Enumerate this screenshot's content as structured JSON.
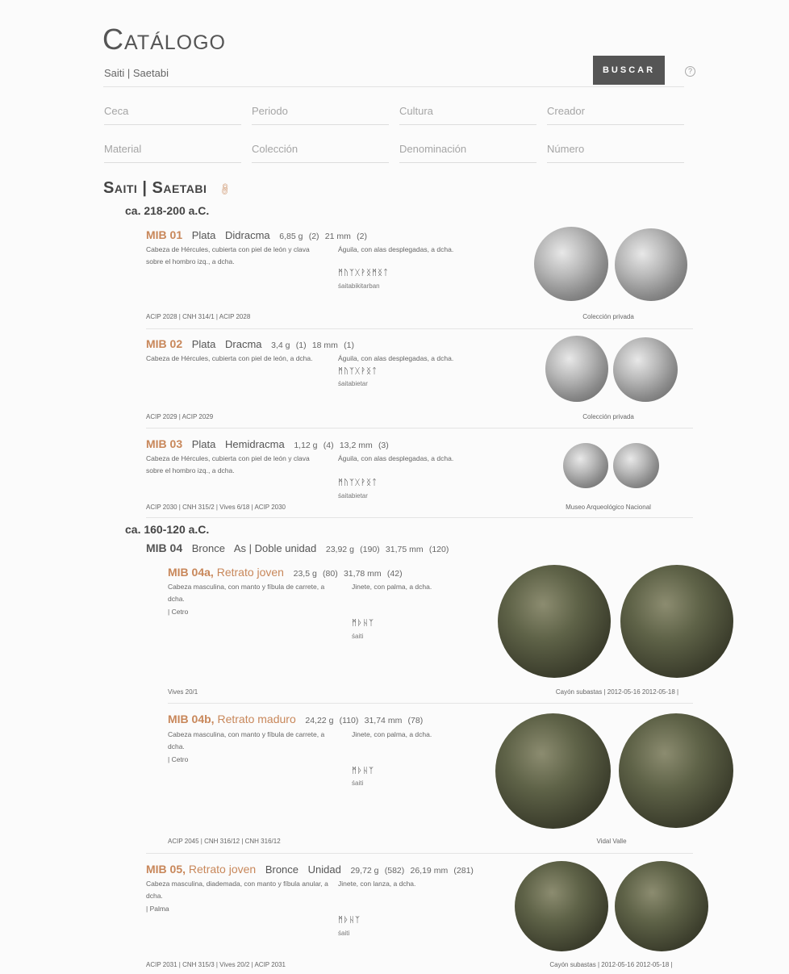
{
  "header": {
    "title": "Catálogo",
    "search_value": "Saiti | Saetabi",
    "search_button": "BUSCAR",
    "help_icon": "?"
  },
  "filters": {
    "ceca": "Ceca",
    "periodo": "Periodo",
    "cultura": "Cultura",
    "creador": "Creador",
    "material": "Material",
    "coleccion": "Colección",
    "denominacion": "Denominación",
    "numero": "Número"
  },
  "mint": {
    "name": "Saiti | Saetabi",
    "link_icon": "link-icon"
  },
  "periods": [
    "ca. 218-200 a.C.",
    "ca. 160-120 a.C."
  ],
  "coins": {
    "mib01": {
      "code": "MIB 01",
      "metal": "Plata",
      "denomination": "Didracma",
      "weight": "6,85 g",
      "weight_n": "(2)",
      "diameter": "21 mm",
      "diameter_n": "(2)",
      "obverse": "Cabeza de Hércules, cubierta con piel de león y clava sobre el hombro izq., a dcha.",
      "reverse": "Águila, con alas desplegadas, a dcha.",
      "legend": "ᛗᚢᛉᚷᚹᛝᛗᛝᛏ",
      "translit": "śaitabikitarban",
      "refs": "ACIP 2028 | CNH 314/1 | ACIP 2028",
      "collection": "Colección privada"
    },
    "mib02": {
      "code": "MIB 02",
      "metal": "Plata",
      "denomination": "Dracma",
      "weight": "3,4 g",
      "weight_n": "(1)",
      "diameter": "18 mm",
      "diameter_n": "(1)",
      "obverse": "Cabeza de Hércules, cubierta con piel de león, a dcha.",
      "reverse": "Águila, con alas desplegadas, a dcha.",
      "legend": "ᛗᚢᛉᚷᚹᛝᛏ",
      "translit": "śaitabietar",
      "refs": "ACIP 2029 | ACIP 2029",
      "collection": "Colección privada"
    },
    "mib03": {
      "code": "MIB 03",
      "metal": "Plata",
      "denomination": "Hemidracma",
      "weight": "1,12 g",
      "weight_n": "(4)",
      "diameter": "13,2 mm",
      "diameter_n": "(3)",
      "obverse": "Cabeza de Hércules, cubierta con piel de león y clava sobre el hombro izq., a dcha.",
      "reverse": "Águila, con alas desplegadas, a dcha.",
      "legend": "ᛗᚢᛉᚷᚹᛝᛏ",
      "translit": "śaitabietar",
      "refs": "ACIP 2030 | CNH 315/2 | Vives 6/18 | ACIP 2030",
      "collection": "Museo Arqueológico Nacional"
    },
    "mib04": {
      "code": "MIB 04",
      "metal": "Bronce",
      "denomination": "As | Doble unidad",
      "weight": "23,92 g",
      "weight_n": "(190)",
      "diameter": "31,75 mm",
      "diameter_n": "(120)"
    },
    "mib04a": {
      "code": "MIB 04a,",
      "subtitle": "Retrato joven",
      "weight": "23,5 g",
      "weight_n": "(80)",
      "diameter": "31,78 mm",
      "diameter_n": "(42)",
      "obverse": "Cabeza masculina, con manto y fíbula de carrete, a dcha.",
      "obverse_extra": "| Cetro",
      "reverse": "Jinete, con palma, a dcha.",
      "legend": "ᛗᚦᚺᛉ",
      "translit": "śaiti",
      "refs": "Vives 20/1",
      "collection": "Cayón subastas | 2012-05-16 2012-05-18 |"
    },
    "mib04b": {
      "code": "MIB 04b,",
      "subtitle": "Retrato maduro",
      "weight": "24,22 g",
      "weight_n": "(110)",
      "diameter": "31,74 mm",
      "diameter_n": "(78)",
      "obverse": "Cabeza masculina, con manto y fíbula de carrete, a dcha.",
      "obverse_extra": "| Cetro",
      "reverse": "Jinete, con palma, a dcha.",
      "legend": "ᛗᚦᚺᛉ",
      "translit": "śaiti",
      "refs": "ACIP 2045 | CNH 316/12 | CNH 316/12",
      "collection": "Vidal Valle"
    },
    "mib05": {
      "code": "MIB 05,",
      "subtitle": "Retrato joven",
      "metal": "Bronce",
      "denomination": "Unidad",
      "weight": "29,72 g",
      "weight_n": "(582)",
      "diameter": "26,19 mm",
      "diameter_n": "(281)",
      "obverse": "Cabeza masculina, diademada, con manto y fíbula anular, a dcha.",
      "obverse_extra": "| Palma",
      "reverse": "Jinete, con lanza, a dcha.",
      "legend": "ᛗᚦᚺᛉ",
      "translit": "śaiti",
      "refs": "ACIP 2031 | CNH 315/3 | Vives 20/2 | ACIP 2031",
      "collection": "Cayón subastas | 2012-05-16 2012-05-18 |"
    }
  }
}
